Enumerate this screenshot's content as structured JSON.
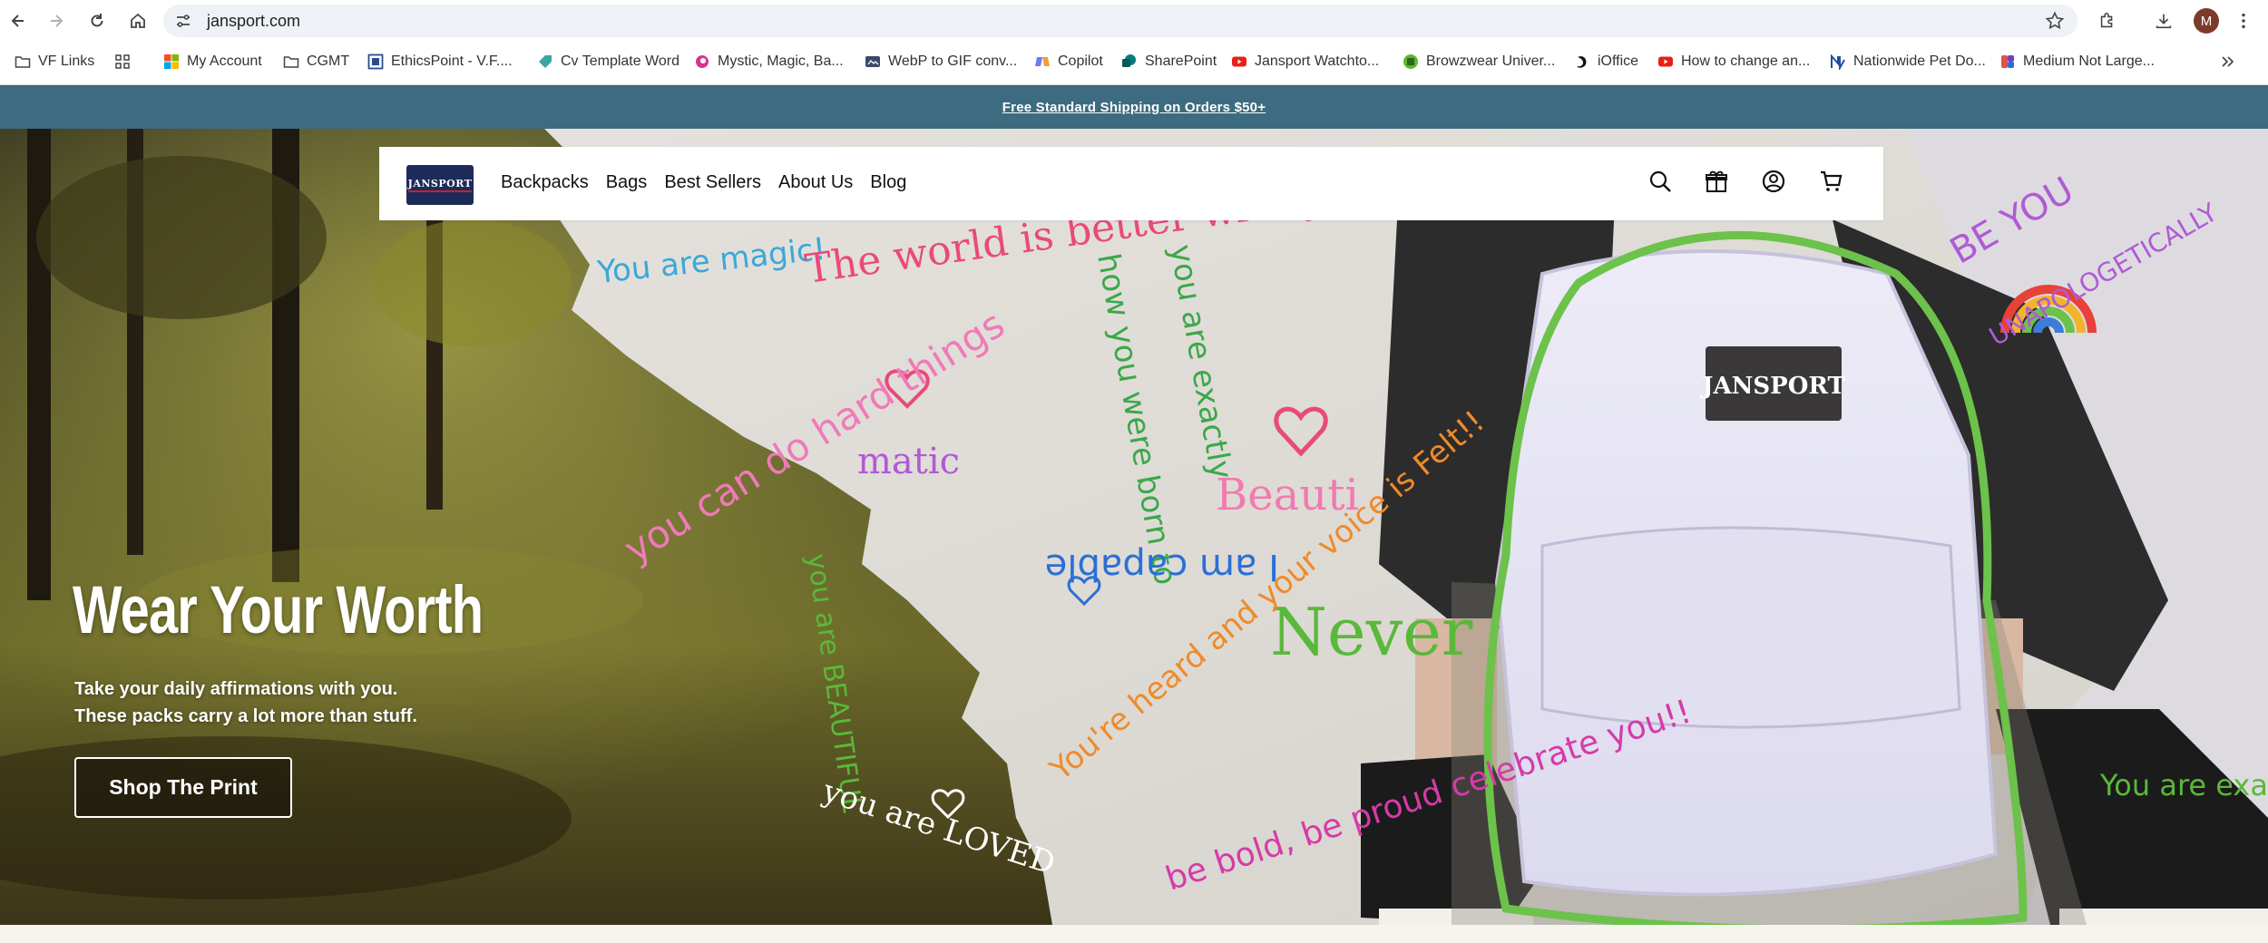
{
  "browser": {
    "url": "jansport.com",
    "avatar_letter": "M",
    "bookmarks": [
      {
        "label": "VF Links",
        "icon": "folder-icon",
        "color": "#5f6368"
      },
      {
        "label": "",
        "icon": "apps-grid-icon",
        "color": "#5f6368"
      },
      {
        "label": "My Account",
        "icon": "microsoft-icon",
        "color": "#f25022"
      },
      {
        "label": "CGMT",
        "icon": "folder-icon",
        "color": "#5f6368"
      },
      {
        "label": "EthicsPoint - V.F....",
        "icon": "ethicspoint-icon",
        "color": "#2a4d8f"
      },
      {
        "label": "Cv Template Word",
        "icon": "tag-icon",
        "color": "#3aa7a3"
      },
      {
        "label": "Mystic, Magic, Ba...",
        "icon": "swirl-icon",
        "color": "#d8348f"
      },
      {
        "label": "WebP to GIF conv...",
        "icon": "converter-icon",
        "color": "#3a4a6b"
      },
      {
        "label": "Copilot",
        "icon": "copilot-icon",
        "color": "#6b7bf5"
      },
      {
        "label": "SharePoint",
        "icon": "sharepoint-icon",
        "color": "#0a7a7a"
      },
      {
        "label": "Jansport Watchto...",
        "icon": "youtube-icon",
        "color": "#e62117"
      },
      {
        "label": "Browzwear Univer...",
        "icon": "browzwear-icon",
        "color": "#5bb832"
      },
      {
        "label": "iOffice",
        "icon": "ioffice-icon",
        "color": "#111111"
      },
      {
        "label": "How to change an...",
        "icon": "youtube-icon",
        "color": "#e62117"
      },
      {
        "label": "Nationwide Pet Do...",
        "icon": "nationwide-icon",
        "color": "#1e4fa3"
      },
      {
        "label": "Medium Not Large...",
        "icon": "medium-icon",
        "color": "#e0524a"
      }
    ]
  },
  "announcement": "Free Standard Shipping on Orders $50+",
  "header": {
    "logo_text": "JANSPORT",
    "menu": [
      "Backpacks",
      "Bags",
      "Best Sellers",
      "About Us",
      "Blog"
    ]
  },
  "hero": {
    "title": "Wear Your Worth",
    "subtitle_line1": "Take your daily affirmations with you.",
    "subtitle_line2": "These packs carry a lot more than stuff.",
    "cta": "Shop The Print",
    "backpack_label": "JANSPORT",
    "affirmations": [
      {
        "text": "You are magic!",
        "color": "#3aa8d8"
      },
      {
        "text": "The world is better with you in it!",
        "color": "#e94a7a"
      },
      {
        "text": "how you were born to",
        "color": "#3ba84a"
      },
      {
        "text": "you are exactly",
        "color": "#3ba84a"
      },
      {
        "text": "you can do hard things",
        "color": "#f07ab8"
      },
      {
        "text": "you are BEAUTIFUL",
        "color": "#5ab83a"
      },
      {
        "text": "matic",
        "color": "#b05ad6"
      },
      {
        "text": "I am capable",
        "color": "#2a6fd6"
      },
      {
        "text": "Beauti",
        "color": "#f27ab0"
      },
      {
        "text": "Never",
        "color": "#5ab83a"
      },
      {
        "text": "You're heard and your voice is Felt!!",
        "color": "#f08a2a"
      },
      {
        "text": "be bold, be proud celebrate you!!",
        "color": "#d63aa8"
      },
      {
        "text": "you are LOVED",
        "color": "#ffffff"
      },
      {
        "text": "BE YOU",
        "color": "#b05ad6"
      },
      {
        "text": "UNAPOLOGETICALLY",
        "color": "#b05ad6"
      },
      {
        "text": "You are exactly",
        "color": "#5ab83a"
      }
    ]
  }
}
